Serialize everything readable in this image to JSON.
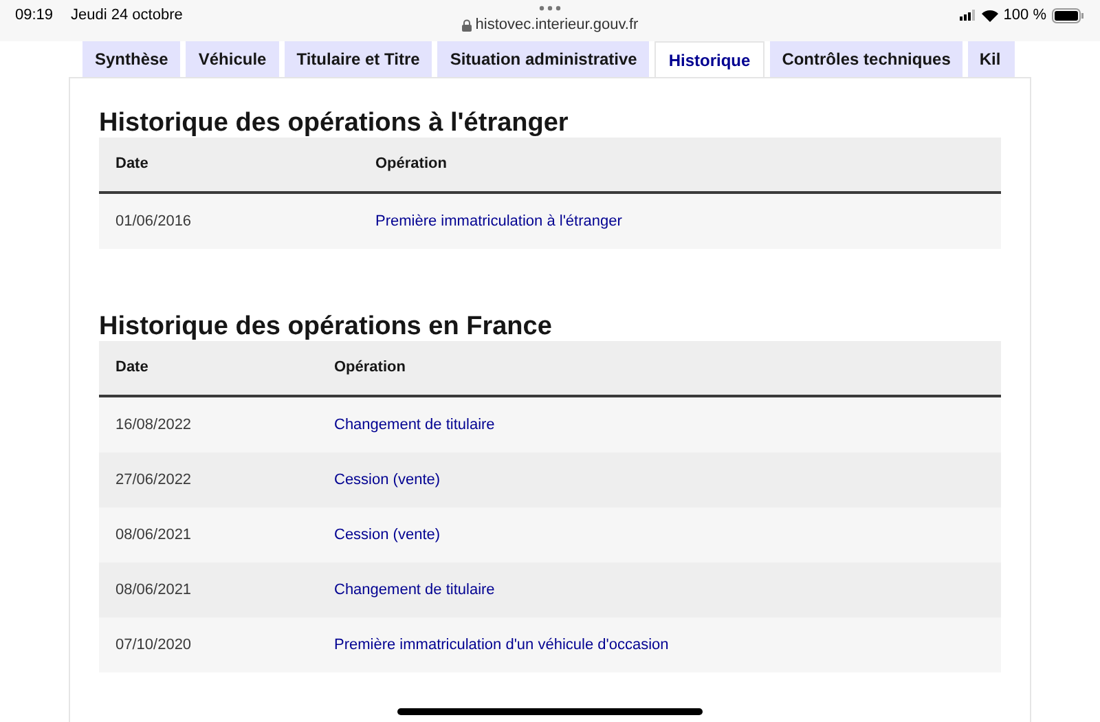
{
  "status_bar": {
    "time": "09:19",
    "date": "Jeudi 24 octobre",
    "url": "histovec.interieur.gouv.fr",
    "battery": "100 %"
  },
  "tabs": [
    {
      "label": "Synthèse",
      "selected": false
    },
    {
      "label": "Véhicule",
      "selected": false
    },
    {
      "label": "Titulaire et Titre",
      "selected": false
    },
    {
      "label": "Situation administrative",
      "selected": false
    },
    {
      "label": "Historique",
      "selected": true
    },
    {
      "label": "Contrôles techniques",
      "selected": false
    },
    {
      "label": "Kil",
      "selected": false
    }
  ],
  "sections": [
    {
      "title": "Historique des opérations à l'étranger",
      "columns": [
        "Date",
        "Opération"
      ],
      "rows": [
        {
          "date": "01/06/2016",
          "operation": "Première immatriculation à l'étranger"
        }
      ]
    },
    {
      "title": "Historique des opérations en France",
      "columns": [
        "Date",
        "Opération"
      ],
      "rows": [
        {
          "date": "16/08/2022",
          "operation": "Changement de titulaire"
        },
        {
          "date": "27/06/2022",
          "operation": "Cession (vente)"
        },
        {
          "date": "08/06/2021",
          "operation": "Cession (vente)"
        },
        {
          "date": "08/06/2021",
          "operation": "Changement de titulaire"
        },
        {
          "date": "07/10/2020",
          "operation": "Première immatriculation d'un véhicule d'occasion"
        }
      ]
    }
  ]
}
